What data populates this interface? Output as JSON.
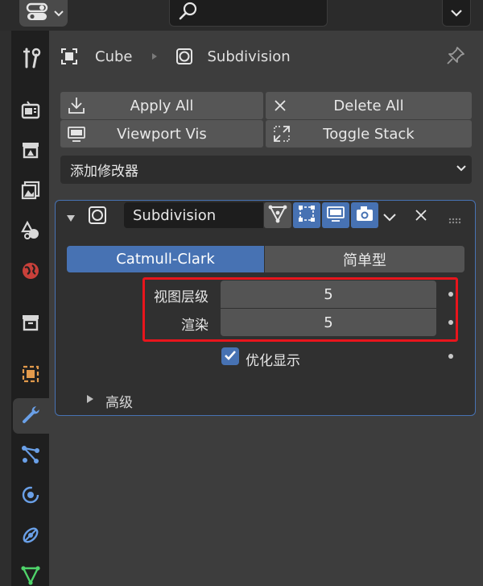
{
  "breadcrumb": {
    "object": "Cube",
    "modifier": "Subdivision"
  },
  "toolbar": {
    "apply_all": "Apply All",
    "delete_all": "Delete All",
    "viewport_vis": "Viewport Vis",
    "toggle_stack": "Toggle Stack"
  },
  "add_modifier": {
    "label": "添加修改器"
  },
  "modifier": {
    "name": "Subdivision",
    "modes": {
      "active": "Catmull-Clark",
      "other": "简单型"
    },
    "levels_viewport_label": "视图层级",
    "levels_viewport_value": "5",
    "render_label": "渲染",
    "render_value": "5",
    "optimal_display_label": "优化显示",
    "optimal_display_checked": true,
    "advanced_label": "高级"
  },
  "colors": {
    "accent": "#4772b3",
    "highlight": "#e8151c",
    "panel": "#303030",
    "bg": "#3d3d3d"
  }
}
